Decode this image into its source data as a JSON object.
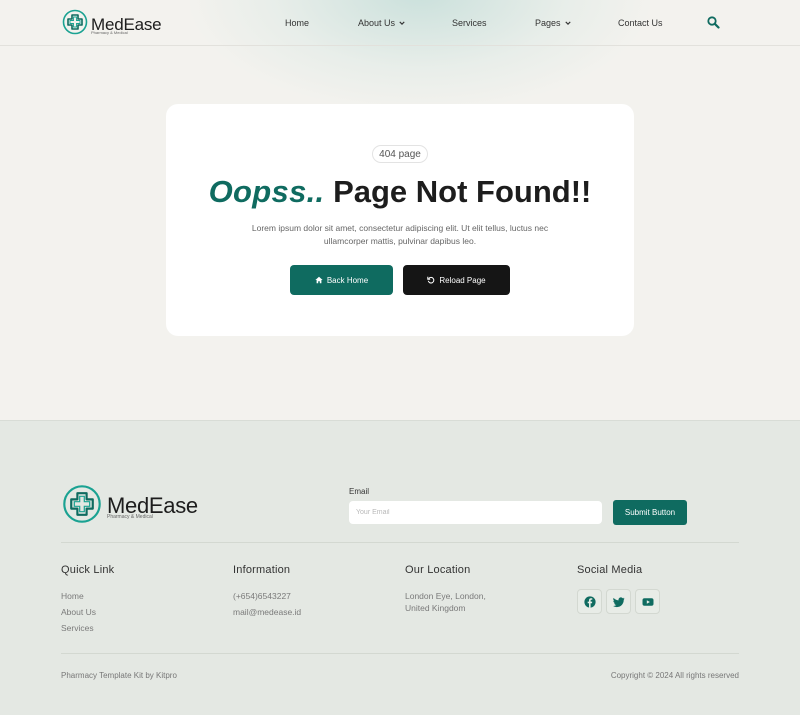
{
  "brand": {
    "name": "MedEase",
    "tagline": "Pharmacy & Medical"
  },
  "nav": {
    "items": [
      {
        "label": "Home"
      },
      {
        "label": "About Us"
      },
      {
        "label": "Services"
      },
      {
        "label": "Pages"
      },
      {
        "label": "Contact Us"
      }
    ],
    "icons": {
      "search": "search-icon",
      "dropdown": "chevron-down-icon"
    }
  },
  "error_card": {
    "badge": "404 page",
    "headline_accent": "Oopss..",
    "headline_rest": "Page Not Found!!",
    "description": "Lorem ipsum dolor sit amet, consectetur adipiscing elit. Ut elit tellus, luctus nec ullamcorper mattis, pulvinar dapibus leo.",
    "back_home_label": "Back Home",
    "reload_label": "Reload Page",
    "icons": {
      "home": "home-icon",
      "reload": "reload-icon"
    }
  },
  "footer": {
    "brand_name": "MedEase",
    "brand_tagline": "Pharmacy & Medical",
    "email_label": "Email",
    "email_placeholder": "Your Email",
    "submit_label": "Submit Button",
    "quick_link": {
      "title": "Quick Link",
      "items": [
        "Home",
        "About Us",
        "Services"
      ]
    },
    "information": {
      "title": "Information",
      "phone": "(+654)6543227",
      "email": "mail@medease.id"
    },
    "location": {
      "title": "Our Location",
      "line1": "London Eye, London,",
      "line2": "United Kingdom"
    },
    "social": {
      "title": "Social Media",
      "icons": [
        "facebook-icon",
        "twitter-icon",
        "youtube-icon"
      ]
    },
    "credit": "Pharmacy Template Kit by Kitpro",
    "copyright": "Copyright © 2024 All rights reserved"
  },
  "colors": {
    "accent": "#0f6b60",
    "dark_button": "#151515",
    "page_bg": "#f3f2ee",
    "footer_bg": "#e4e8e3"
  }
}
